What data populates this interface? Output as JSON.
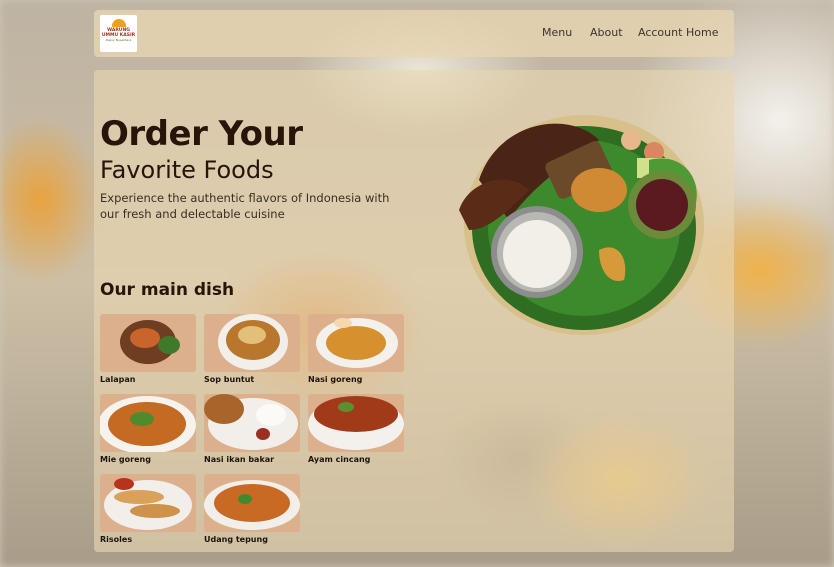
{
  "header": {
    "logo": {
      "line1": "WARUNG UMMU KASIR",
      "line2": "Dapur Nusantara"
    },
    "nav": [
      "Menu",
      "About",
      "Account",
      "Home"
    ]
  },
  "hero": {
    "title": "Order Your",
    "subtitle": "Favorite Foods",
    "description": "Experience the authentic flavors of Indonesia with our fresh and delectable cuisine",
    "section_title": "Our main dish",
    "dishes": [
      {
        "name": "Lalapan"
      },
      {
        "name": "Sop buntut"
      },
      {
        "name": "Nasi goreng"
      },
      {
        "name": "Mie goreng"
      },
      {
        "name": "Nasi ikan bakar"
      },
      {
        "name": "Ayam cincang"
      },
      {
        "name": "Risoles"
      },
      {
        "name": "Udang tepung"
      }
    ]
  },
  "colors": {
    "accent": "#e8a21c",
    "text_dark": "#2a1308",
    "panel": "#e8d6b2"
  }
}
